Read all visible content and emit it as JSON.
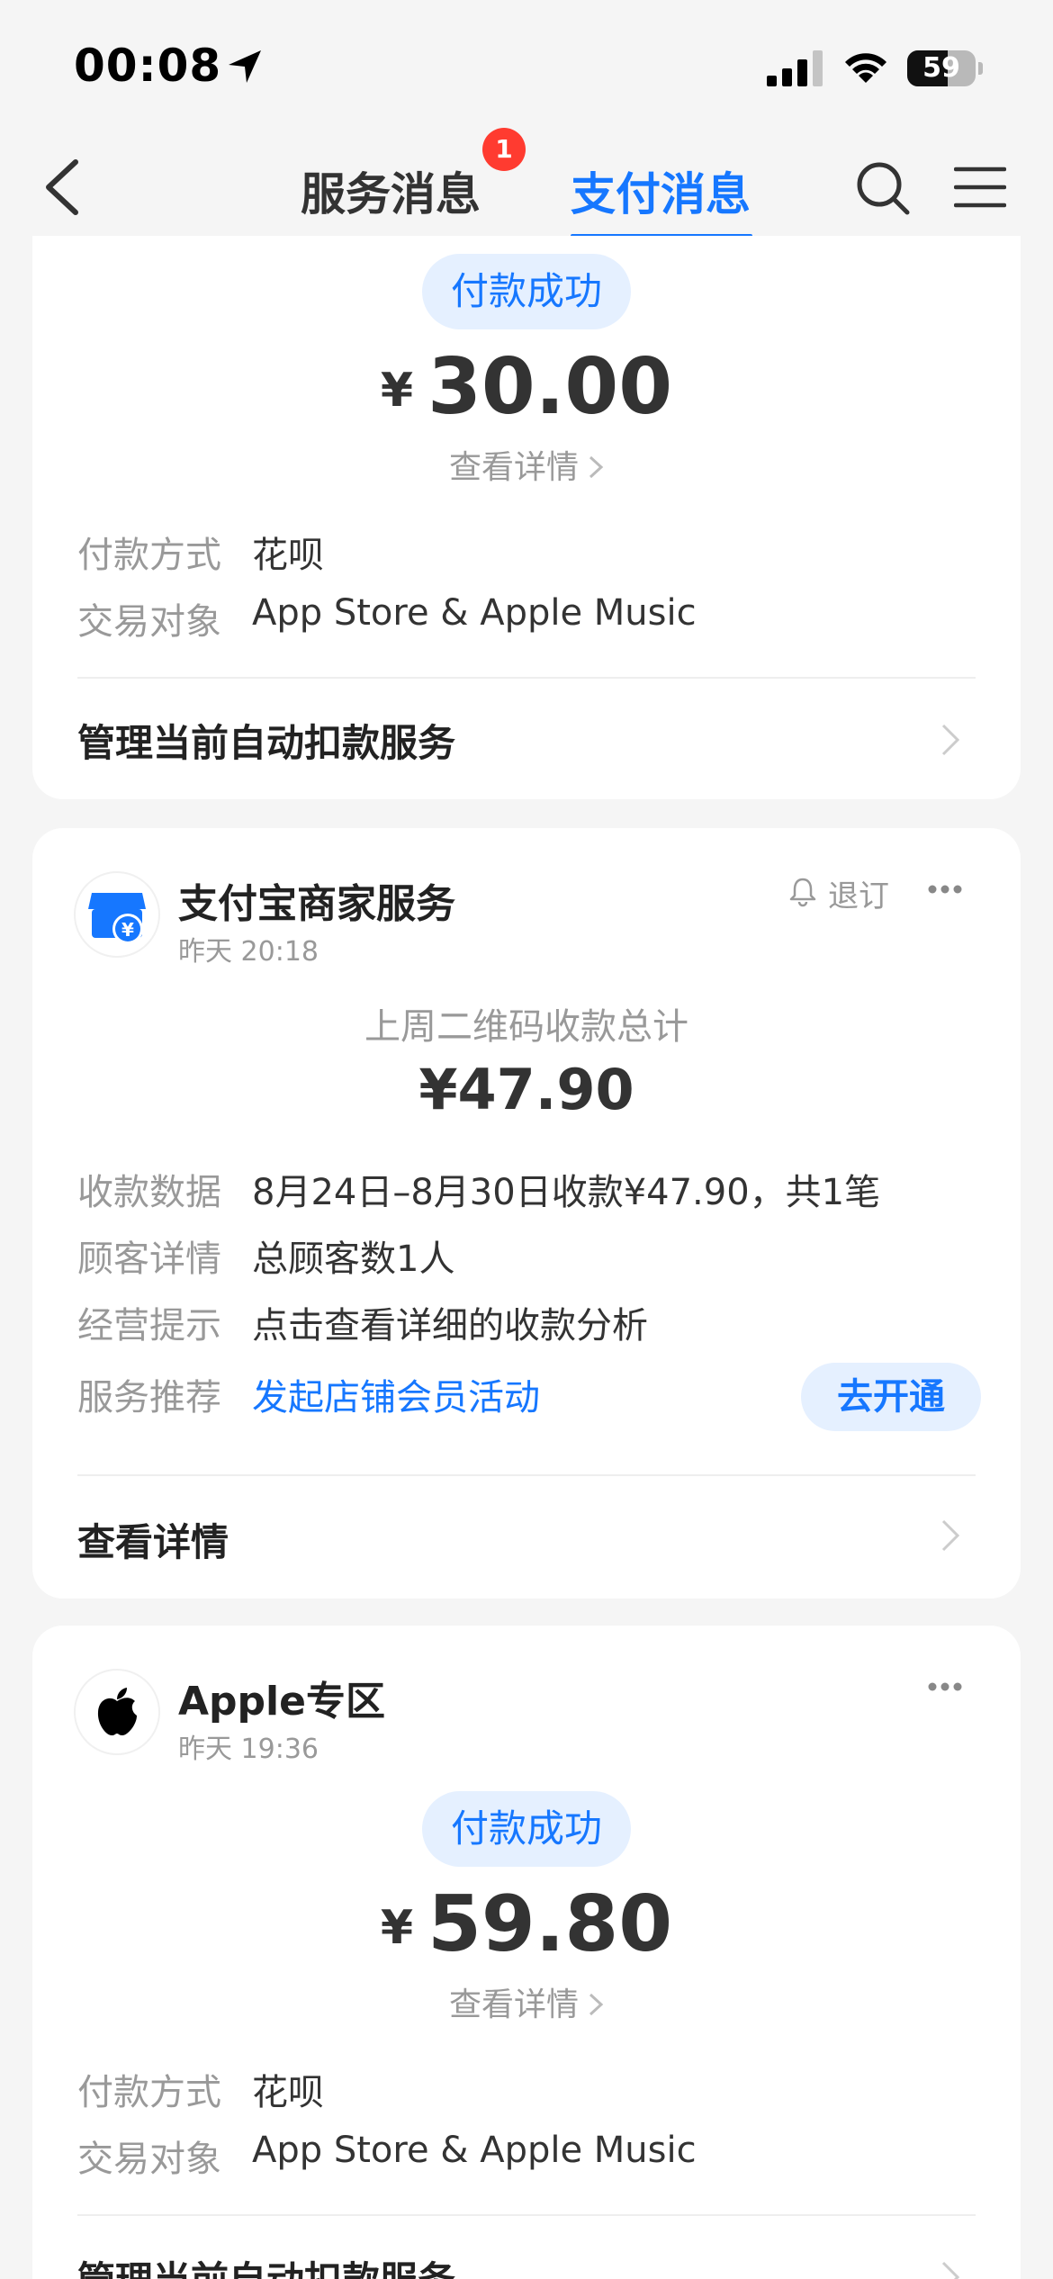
{
  "status_bar": {
    "time": "00:08",
    "battery": "59",
    "battery_level": 0.59
  },
  "nav": {
    "tabs": [
      {
        "label": "服务消息",
        "badge": "1"
      },
      {
        "label": "支付消息"
      }
    ]
  },
  "cards": [
    {
      "status": "付款成功",
      "currency": "¥",
      "amount": "30.00",
      "detail_link": "查看详情",
      "rows": [
        {
          "label": "付款方式",
          "value": "花呗"
        },
        {
          "label": "交易对象",
          "value": "App Store & Apple Music"
        }
      ],
      "action": "管理当前自动扣款服务"
    },
    {
      "merchant": "支付宝商家服务",
      "time": "昨天 20:18",
      "unsubscribe": "退订",
      "summary_title": "上周二维码收款总计",
      "summary_amount": "¥47.90",
      "rows": [
        {
          "label": "收款数据",
          "value": "8月24日–8月30日收款¥47.90，共1笔"
        },
        {
          "label": "顾客详情",
          "value": "总顾客数1人"
        },
        {
          "label": "经营提示",
          "value": "点击查看详细的收款分析"
        },
        {
          "label": "服务推荐",
          "value": "发起店铺会员活动"
        }
      ],
      "open_button": "去开通",
      "action": "查看详情"
    },
    {
      "merchant": "Apple专区",
      "time": "昨天 19:36",
      "status": "付款成功",
      "currency": "¥",
      "amount": "59.80",
      "detail_link": "查看详情",
      "rows": [
        {
          "label": "付款方式",
          "value": "花呗"
        },
        {
          "label": "交易对象",
          "value": "App Store & Apple Music"
        }
      ],
      "action": "管理当前自动扣款服务"
    }
  ],
  "colors": {
    "accent": "#1677ff",
    "badge": "#ff3b30",
    "background": "#f5f5f5"
  }
}
